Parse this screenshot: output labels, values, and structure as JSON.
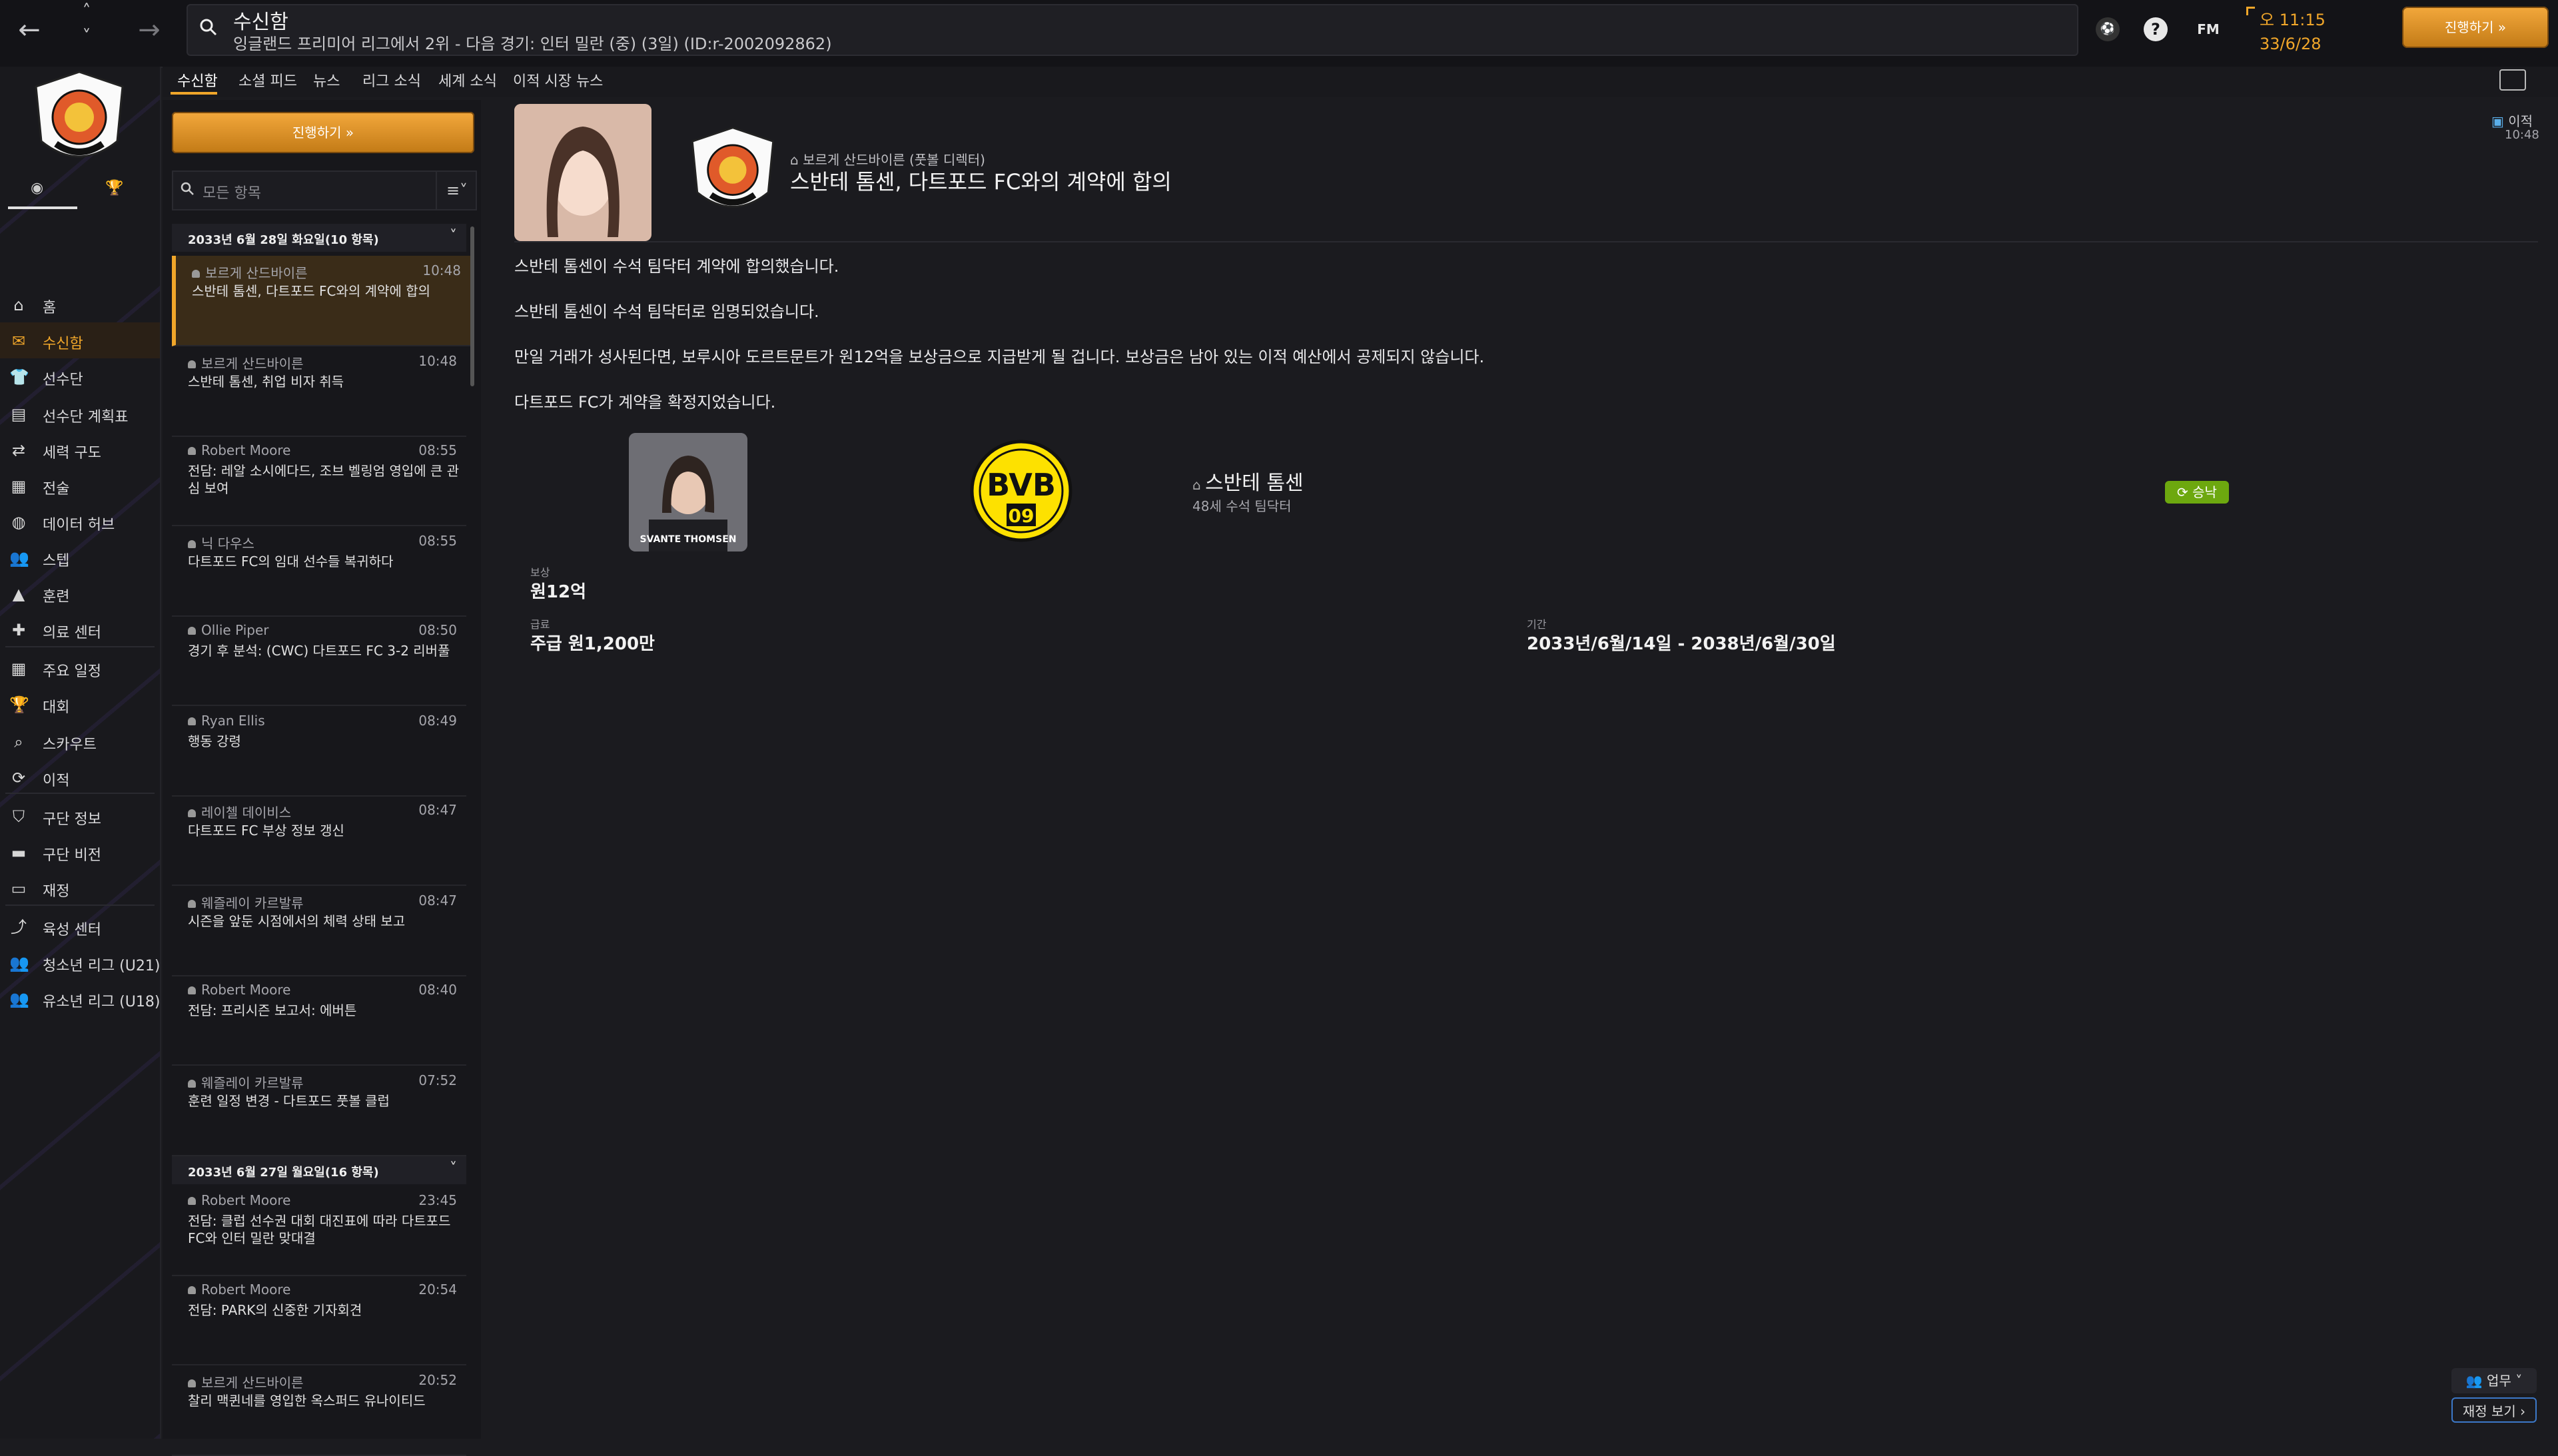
{
  "header": {
    "title": "수신함",
    "subtitle": "잉글랜드 프리미어 리그에서 2위 - 다음 경기: 인터 밀란 (중) (3일) (ID:r-2002092862)",
    "time": "오 11:15",
    "date": "33/6/28",
    "continue_label": "진행하기",
    "fm_label": "FM",
    "help_label": "?"
  },
  "sidebar": {
    "items": [
      {
        "label": "홈",
        "icon": "home-icon"
      },
      {
        "label": "수신함",
        "icon": "inbox-icon"
      },
      {
        "label": "선수단",
        "icon": "squad-icon"
      },
      {
        "label": "선수단 계획표",
        "icon": "plan-icon"
      },
      {
        "label": "세력 구도",
        "icon": "dynamics-icon"
      },
      {
        "label": "전술",
        "icon": "tactics-icon"
      },
      {
        "label": "데이터 허브",
        "icon": "data-hub-icon"
      },
      {
        "label": "스텝",
        "icon": "staff-icon"
      },
      {
        "label": "훈련",
        "icon": "training-icon"
      },
      {
        "label": "의료 센터",
        "icon": "medical-icon"
      },
      {
        "label": "주요 일정",
        "icon": "calendar-icon"
      },
      {
        "label": "대회",
        "icon": "trophy-icon"
      },
      {
        "label": "스카우트",
        "icon": "scout-icon"
      },
      {
        "label": "이적",
        "icon": "transfer-icon"
      },
      {
        "label": "구단 정보",
        "icon": "club-info-icon"
      },
      {
        "label": "구단 비전",
        "icon": "club-vision-icon"
      },
      {
        "label": "재정",
        "icon": "finance-icon"
      },
      {
        "label": "육성 센터",
        "icon": "development-icon"
      },
      {
        "label": "청소년 리그 (U21)",
        "icon": "u21-icon"
      },
      {
        "label": "유소년 리그 (U18)",
        "icon": "u18-icon"
      }
    ]
  },
  "tabs": [
    "수신함",
    "소셜 피드",
    "뉴스",
    "리그 소식",
    "세계 소식",
    "이적 시장 뉴스"
  ],
  "list": {
    "continue_label": "진행하기",
    "search_placeholder": "모든 항목",
    "filter_icon": "filter-icon",
    "group1": "2033년 6월 28일 화요일(10 항목)",
    "group2": "2033년 6월 27일 월요일(16 항목)",
    "messages": [
      {
        "from": "보르게 산드바이른",
        "time": "10:48",
        "subject": "스반테 톰센, 다트포드 FC와의 계약에 합의"
      },
      {
        "from": "보르게 산드바이른",
        "time": "10:48",
        "subject": "스반테 톰센, 취업 비자 취득"
      },
      {
        "from": "Robert Moore",
        "time": "08:55",
        "subject": "전담: 레알 소시에다드, 조브 벨링엄 영입에 큰 관심 보여"
      },
      {
        "from": "닉 다우스",
        "time": "08:55",
        "subject": "다트포드 FC의 임대 선수들 복귀하다"
      },
      {
        "from": "Ollie Piper",
        "time": "08:50",
        "subject": "경기 후 분석: (CWC) 다트포드 FC 3-2 리버풀"
      },
      {
        "from": "Ryan Ellis",
        "time": "08:49",
        "subject": "행동 강령"
      },
      {
        "from": "레이첼 데이비스",
        "time": "08:47",
        "subject": "다트포드 FC 부상 정보 갱신"
      },
      {
        "from": "웨즐레이 카르발류",
        "time": "08:47",
        "subject": "시즌을 앞둔 시점에서의 체력 상태 보고"
      },
      {
        "from": "Robert Moore",
        "time": "08:40",
        "subject": "전담: 프리시즌 보고서: 에버튼"
      },
      {
        "from": "웨즐레이 카르발류",
        "time": "07:52",
        "subject": "훈련 일정 변경 - 다트포드 풋볼 클럽"
      },
      {
        "from": "Robert Moore",
        "time": "23:45",
        "subject": "전담: 클럽 선수권 대회 대진표에 따라 다트포드 FC와 인터 밀란 맞대결"
      },
      {
        "from": "Robert Moore",
        "time": "20:54",
        "subject": "전담: PARK의 신중한 기자회견"
      },
      {
        "from": "보르게 산드바이른",
        "time": "20:52",
        "subject": "찰리 맥퀸네를 영입한 옥스퍼드 유나이티드"
      }
    ]
  },
  "detail": {
    "sender": "보르게 산드바이른 (풋볼 디렉터)",
    "subject": "스반테 톰센, 다트포드 FC와의 계약에 합의",
    "tag": "이적",
    "time": "10:48",
    "paragraphs": [
      "스반테 톰센이 수석 팀닥터 계약에 합의했습니다.",
      "스반테 톰센이 수석 팀닥터로 임명되었습니다.",
      "만일 거래가 성사된다면, 보루시아 도르트문트가 원12억을 보상금으로 지급받게 될 겁니다. 보상금은 남아 있는 이적 예산에서 공제되지 않습니다.",
      "다트포드 FC가 계약을 확정지었습니다."
    ],
    "staff": {
      "name": "스반테 톰센",
      "role": "48세 수석 팀닥터",
      "photo_caption": "SVANTE THOMSEN",
      "status": "승낙"
    },
    "compensation_label": "보상",
    "compensation_value": "원12억",
    "wage_label": "급료",
    "wage_value": "주급 원1,200만",
    "period_label": "기간",
    "period_value": "2033년/6월/14일 - 2038년/6월/30일",
    "bvb_text": "BVB",
    "bvb_num": "09"
  },
  "footer": {
    "duty_label": "업무",
    "finance_label": "재정 보기"
  },
  "colors": {
    "accent": "#f0a62a",
    "status_green": "#6da80f",
    "bvb_yellow": "#fde100"
  }
}
